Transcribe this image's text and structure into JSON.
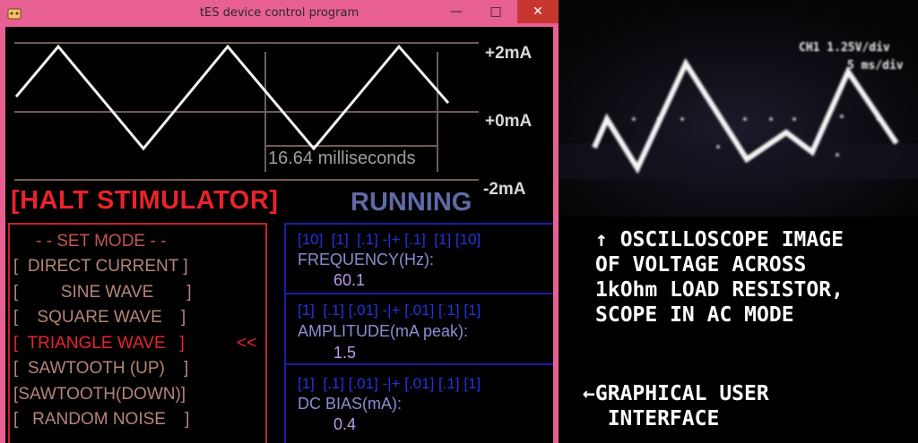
{
  "window": {
    "title": "tES device control program",
    "minimize_icon": "minimize-icon",
    "maximize_icon": "maximize-icon",
    "close_icon": "close-icon",
    "app_icon": "pink-app-icon"
  },
  "scope_display": {
    "axis_labels": [
      "+2mA",
      "+0mA",
      "-2mA"
    ],
    "period_label": "16.64 milliseconds",
    "waveform": "triangle"
  },
  "status": {
    "halt_button": "[HALT STIMULATOR]",
    "state": "RUNNING"
  },
  "modes": {
    "title": "- - SET MODE -  -",
    "items": [
      "[  DIRECT CURRENT ]",
      "[         SINE WAVE       ]",
      "[    SQUARE WAVE    ]",
      "[  TRIANGLE WAVE   ]",
      "[  SAWTOOTH (UP)    ]",
      "[SAWTOOTH(DOWN)]",
      "[   RANDOM NOISE    ]"
    ],
    "selected_marker": "<<"
  },
  "controls": {
    "frequency": {
      "steps": "[10]  [1]  [.1] -|+ [.1]  [1] [10]",
      "label": "FREQUENCY(Hz):",
      "value": "60.1"
    },
    "amplitude": {
      "steps": "[1]  [.1] [.01] -|+ [.01] [.1] [1]",
      "label": "AMPLITUDE(mA peak):",
      "value": "1.5"
    },
    "dc_bias": {
      "steps": "[1]  [.1] [.01] -|+ [.01] [.1] [1]",
      "label": "DC BIAS(mA):",
      "value": "0.4"
    }
  },
  "annotations": {
    "scope_note": "↑ OSCILLOSCOPE IMAGE\nOF VOLTAGE ACROSS\n1kOhm LOAD RESISTOR,\nSCOPE IN AC MODE",
    "gui_note": "←GRAPHICAL USER\n  INTERFACE"
  },
  "oscilloscope_photo": {
    "readout_1": "CH1 1.25V/div",
    "readout_2": "5 ms/div"
  },
  "colors": {
    "window_frame": "#e85f94",
    "halt_red": "#e8242a",
    "running_blue": "#5f6aa6",
    "control_border": "#1b1ba8",
    "mode_border": "#c2232b"
  }
}
